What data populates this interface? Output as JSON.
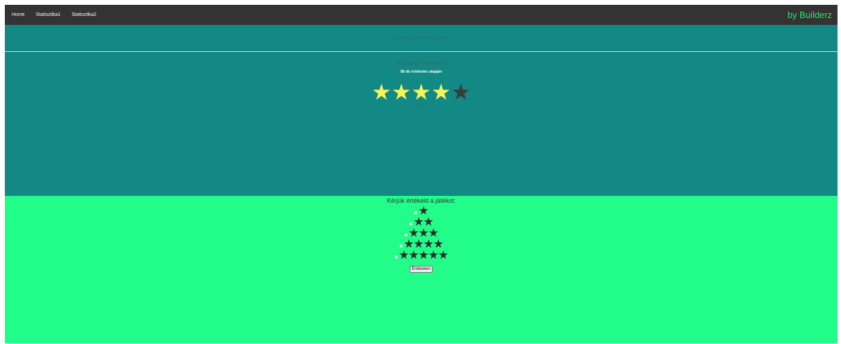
{
  "nav": {
    "links": [
      "Home",
      "Statisztika1",
      "Statisztika2"
    ],
    "brand": "by Builderz"
  },
  "info": {
    "message": "Reméljük, tetszett a játék.",
    "rating_title": "Jelenlegi értékelés:",
    "rating_count": "58 db értékelés alapján",
    "stars_filled": 4,
    "stars_total": 5,
    "rating_value": "4.1/5"
  },
  "vote": {
    "title": "Kérjük értékeld a játékot:",
    "options": [
      "★",
      "★★",
      "★★★",
      "★★★★",
      "★★★★★"
    ],
    "submit_label": "Értékelem"
  },
  "colors": {
    "navbar": "#333333",
    "brand": "#26e86a",
    "info_bg": "#138986",
    "vote_bg": "#22fd8a",
    "star_on": "#f4f45a",
    "star_off": "#3b3b3b"
  },
  "icons": [
    "star-icon"
  ]
}
